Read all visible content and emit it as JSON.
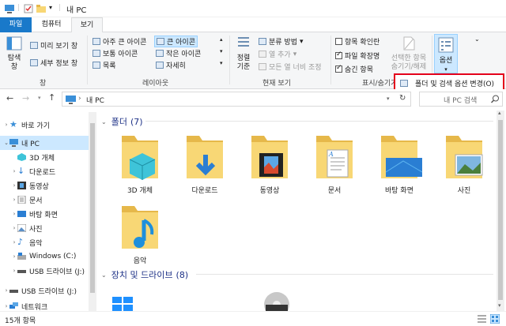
{
  "window": {
    "title": "내 PC"
  },
  "tabs": [
    {
      "label": "파일"
    },
    {
      "label": "컴퓨터"
    },
    {
      "label": "보기"
    }
  ],
  "ribbon": {
    "pane": {
      "nav_pane": "탐색\n창",
      "preview_pane": "미리 보기 창",
      "details_pane": "세부 정보 창",
      "group": "창"
    },
    "layout": {
      "extra_large": "아주 큰 아이콘",
      "large": "큰 아이콘",
      "medium": "보통 아이콘",
      "small": "작은 아이콘",
      "list": "목록",
      "details": "자세히",
      "group": "레이아웃"
    },
    "current_view": {
      "sort_by": "정렬\n기준",
      "group_by": "분류 방법",
      "add_columns": "열 추가",
      "fit_columns": "모든 열 너비 조정",
      "group": "현재 보기"
    },
    "show_hide": {
      "item_checkboxes": "항목 확인란",
      "file_extensions": "파일 확장명",
      "hidden_items": "숨긴 항목",
      "hide_selected": "선택한 항목\n숨기기/해제",
      "group": "표시/숨기기"
    },
    "options": {
      "label": "옵션"
    },
    "dropdown": {
      "change_options": "폴더 및 검색 옵션 변경(O)"
    }
  },
  "address": {
    "path": "내 PC",
    "search_placeholder": "내 PC 검색"
  },
  "nav": {
    "quick_access": "바로 가기",
    "this_pc": "내 PC",
    "objects3d": "3D 개체",
    "downloads": "다운로드",
    "videos": "동영상",
    "documents": "문서",
    "desktop": "바탕 화면",
    "pictures": "사진",
    "music": "음악",
    "windows_c": "Windows (C:)",
    "usb_j": "USB 드라이브 (J:)",
    "usb_j2": "USB 드라이브 (J:)",
    "network": "네트워크"
  },
  "content": {
    "folders_header": "폴더",
    "folders_count": "(7)",
    "devices_header": "장치 및 드라이브",
    "devices_count": "(8)",
    "folders": [
      {
        "label": "3D 개체"
      },
      {
        "label": "다운로드"
      },
      {
        "label": "동영상"
      },
      {
        "label": "문서"
      },
      {
        "label": "바탕 화면"
      },
      {
        "label": "사진"
      },
      {
        "label": "음악"
      }
    ]
  },
  "status": {
    "count": "15개 항목"
  },
  "colors": {
    "accent": "#1979ca",
    "highlight": "#e4001b",
    "folder": "#f8d775"
  }
}
